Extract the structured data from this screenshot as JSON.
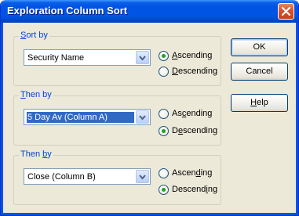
{
  "window": {
    "title": "Exploration Column Sort"
  },
  "groups": [
    {
      "label_pre": "",
      "label_key": "S",
      "label_post": "ort by",
      "selected": "Security Name",
      "asc_pre": "",
      "asc_key": "A",
      "asc_post": "scending",
      "desc_pre": "",
      "desc_key": "D",
      "desc_post": "escending",
      "checked": "ascending"
    },
    {
      "label_pre": "",
      "label_key": "T",
      "label_post": "hen by",
      "selected": "5 Day Av (Column A)",
      "asc_pre": "As",
      "asc_key": "c",
      "asc_post": "ending",
      "desc_pre": "D",
      "desc_key": "e",
      "desc_post": "scending",
      "checked": "descending"
    },
    {
      "label_pre": "Then ",
      "label_key": "b",
      "label_post": "y",
      "selected": "Close (Column B)",
      "asc_pre": "Ascen",
      "asc_key": "d",
      "asc_post": "ing",
      "desc_pre": "Descend",
      "desc_key": "i",
      "desc_post": "ng",
      "checked": "descending"
    }
  ],
  "buttons": {
    "ok": "OK",
    "cancel": "Cancel",
    "help_pre": "",
    "help_key": "H",
    "help_post": "elp"
  }
}
